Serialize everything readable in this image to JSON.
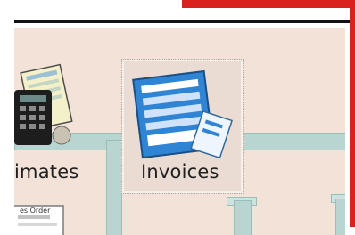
{
  "colors": {
    "accent_red": "#d9211d",
    "canvas_bg": "#f2e2d8",
    "pipe": "#b9d5d2"
  },
  "icons": {
    "estimates_icon": "estimates-document-calculator-icon",
    "invoices_icon": "invoices-document-icon",
    "sales_order_icon": "sales-order-document-icon"
  },
  "workflow": {
    "estimates_label": "imates",
    "invoices_label": "Invoices",
    "sales_order_text": "es Order"
  }
}
